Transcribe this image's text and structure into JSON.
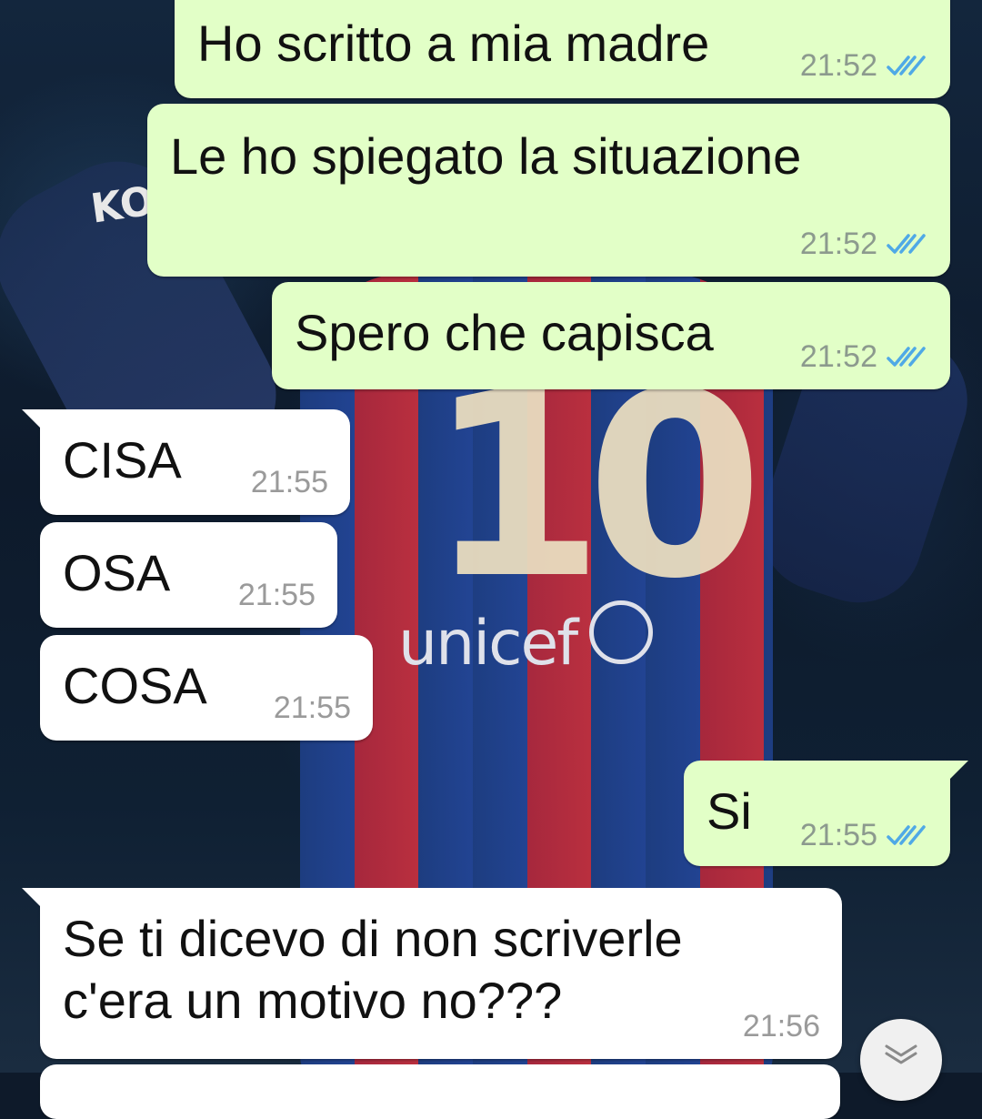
{
  "wallpaper": {
    "shirt_number": "10",
    "sponsor": "unicef",
    "brand_mark": "KO"
  },
  "messages": [
    {
      "direction": "out",
      "text": "Ho scritto a mia madre",
      "time": "21:52",
      "status": "read"
    },
    {
      "direction": "out",
      "text": "Le ho spiegato la situazione",
      "time": "21:52",
      "status": "read"
    },
    {
      "direction": "out",
      "text": "Spero che capisca",
      "time": "21:52",
      "status": "read"
    },
    {
      "direction": "in",
      "text": "CISA",
      "time": "21:55"
    },
    {
      "direction": "in",
      "text": "OSA",
      "time": "21:55"
    },
    {
      "direction": "in",
      "text": "COSA",
      "time": "21:55"
    },
    {
      "direction": "out",
      "text": "Si",
      "time": "21:55",
      "status": "read"
    },
    {
      "direction": "in",
      "text": "Se ti dicevo di non scriverle\nc'era un motivo no???",
      "time": "21:56"
    }
  ],
  "colors": {
    "outgoing_bubble": "#e2ffc7",
    "incoming_bubble": "#ffffff",
    "read_ticks": "#4fa9e6"
  },
  "scroll_button": {
    "icon": "chevron-double-down-icon"
  }
}
